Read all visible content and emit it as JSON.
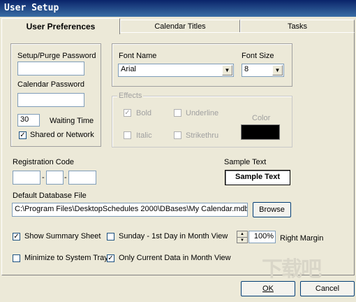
{
  "window": {
    "title": "User Setup"
  },
  "tabs": [
    "User Preferences",
    "Calendar Titles",
    "Tasks"
  ],
  "security": {
    "setup_password_label": "Setup/Purge Password",
    "setup_password_value": "",
    "calendar_password_label": "Calendar Password",
    "calendar_password_value": "",
    "waiting_time_value": "30",
    "waiting_time_label": "Waiting Time",
    "shared_label": "Shared or Network",
    "shared_checked": true
  },
  "font": {
    "name_label": "Font Name",
    "name_value": "Arial",
    "size_label": "Font Size",
    "size_value": "8",
    "effects_label": "Effects",
    "bold_label": "Bold",
    "underline_label": "Underline",
    "italic_label": "Italic",
    "strikethru_label": "Strikethru",
    "color_label": "Color",
    "color_value": "#000000"
  },
  "registration": {
    "label": "Registration Code",
    "part1": "",
    "part2": "",
    "part3": "",
    "dash": "-"
  },
  "sample": {
    "label": "Sample Text",
    "text": "Sample Text"
  },
  "database": {
    "label": "Default Database File",
    "path": "C:\\Program Files\\DesktopSchedules 2000\\DBases\\My Calendar.mdb",
    "browse_label": "Browse"
  },
  "options": {
    "show_summary_label": "Show Summary Sheet",
    "show_summary_checked": true,
    "sunday_label": "Sunday - 1st Day in Month View",
    "sunday_checked": false,
    "margin_value": "100%",
    "margin_label": "Right Margin",
    "minimize_label": "Minimize to System Tray",
    "minimize_checked": false,
    "only_current_label": "Only Current Data in Month View",
    "only_current_checked": true
  },
  "buttons": {
    "ok_label": "OK",
    "cancel_label": "Cancel"
  },
  "watermark": {
    "text": "下载吧"
  }
}
